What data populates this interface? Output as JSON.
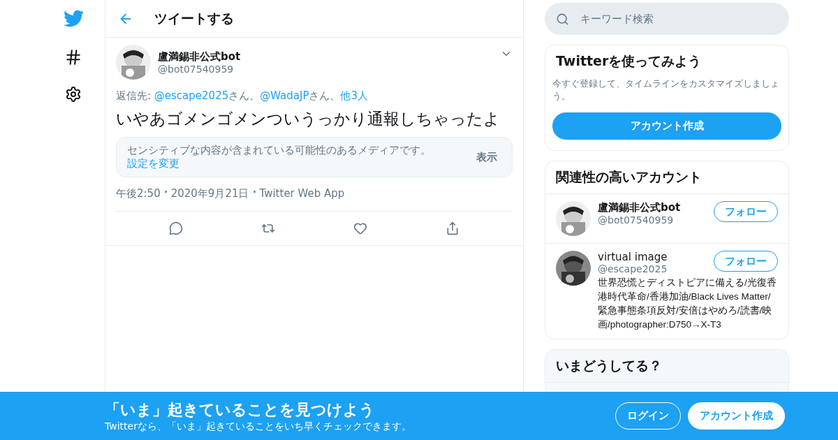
{
  "header": {
    "title": "ツイートする"
  },
  "tweet": {
    "author": {
      "name": "盧満錫非公式bot",
      "handle": "@bot07540959"
    },
    "reply_to": {
      "prefix": "返信先: ",
      "parts": [
        {
          "kind": "link",
          "text": "@escape2025"
        },
        {
          "kind": "plain",
          "text": "さん、"
        },
        {
          "kind": "link",
          "text": "@WadaJP"
        },
        {
          "kind": "plain",
          "text": "さん、"
        },
        {
          "kind": "link",
          "text": "他3人"
        }
      ]
    },
    "text": "いやあゴメンゴメンついうっかり通報しちゃったよ",
    "sensitive": {
      "message": "センシティブな内容が含まれている可能性のあるメディアです。",
      "link": "設定を変更",
      "button": "表示"
    },
    "meta": [
      "午後2:50",
      "2020年9月21日",
      "Twitter Web App"
    ],
    "actions": [
      {
        "kind": "reply"
      },
      {
        "kind": "retweet"
      },
      {
        "kind": "like"
      },
      {
        "kind": "share"
      }
    ]
  },
  "search": {
    "placeholder": "キーワード検索"
  },
  "signup_card": {
    "title": "Twitterを使ってみよう",
    "text": "今すぐ登録して、タイムラインをカスタマイズしましょう。",
    "button": "アカウント作成"
  },
  "related": {
    "title": "関連性の高いアカウント",
    "accounts": [
      {
        "name": "盧満錫非公式bot",
        "handle": "@bot07540959",
        "button": "フォロー"
      },
      {
        "name": "virtual image",
        "handle": "@escape2025",
        "button": "フォロー",
        "bio": "世界恐慌とディストピアに備える/光復香港時代革命/香港加油/Black Lives Matter/緊急事態条項反対/安倍はやめろ/読書/映画/photographer:D750→X-T3"
      }
    ]
  },
  "trends": {
    "title": "いまどうしてる？"
  },
  "banner": {
    "title": "「いま」起きていることを見つけよう",
    "subtitle": "Twitterなら、「いま」起きていることをいち早くチェックできます。",
    "login": "ログイン",
    "signup": "アカウント作成"
  }
}
